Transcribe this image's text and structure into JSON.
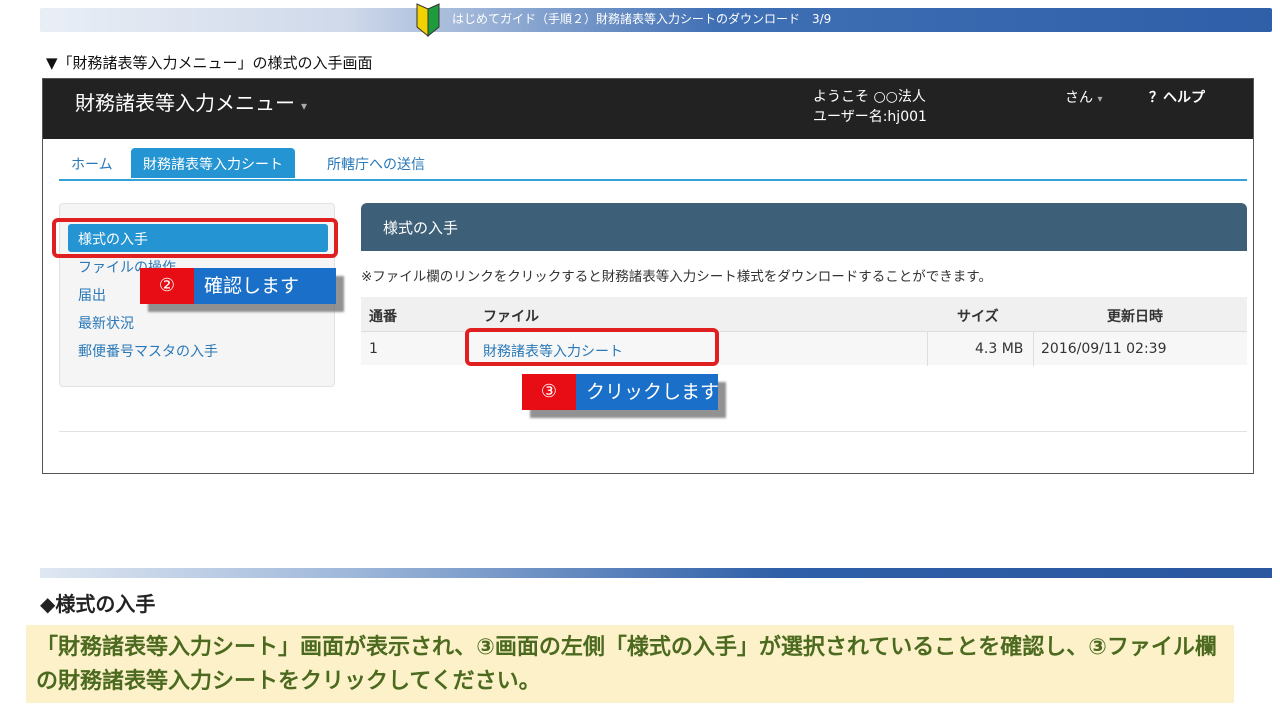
{
  "banner": {
    "text": "はじめてガイド（手順２）財務諸表等入力シートのダウンロード　3/9",
    "icon": "beginner-mark-icon"
  },
  "caption": "▼「財務諸表等入力メニュー」の様式の入手画面",
  "app": {
    "brand": "財務諸表等入力メニュー",
    "brand_caret": "▾",
    "welcome_line1": "ようこそ ○○法人",
    "welcome_line2": "ユーザー名:hj001",
    "user_label": "さん",
    "user_caret": "▾",
    "help_label": "？ヘルプ",
    "tabs": [
      {
        "label": "ホーム"
      },
      {
        "label": "財務諸表等入力シート",
        "active": true
      },
      {
        "label": "所轄庁への送信"
      }
    ],
    "sidebar": [
      {
        "label": "様式の入手",
        "active": true
      },
      {
        "label": "ファイルの操作"
      },
      {
        "label": "届出"
      },
      {
        "label": "最新状況"
      },
      {
        "label": "郵便番号マスタの入手"
      }
    ],
    "panel_title": "様式の入手",
    "note": "※ファイル欄のリンクをクリックすると財務諸表等入力シート様式をダウンロードすることができます。",
    "table": {
      "headers": [
        "通番",
        "ファイル",
        "サイズ",
        "更新日時"
      ],
      "rows": [
        {
          "no": "1",
          "file": "財務諸表等入力シート",
          "size": "4.3 MB",
          "updated": "2016/09/11 02:39"
        }
      ]
    }
  },
  "callouts": [
    {
      "num": "②",
      "text": "確認します"
    },
    {
      "num": "③",
      "text": "クリックします"
    }
  ],
  "colors": {
    "highlight": "#e02020",
    "callout_num": "#e80d15",
    "callout_text": "#1a6fc8",
    "navbar": "#222222",
    "accent": "#2494d3"
  },
  "section_title": "◆様式の入手",
  "description": "「財務諸表等入力シート」画面が表示され、③画面の左側「様式の入手」が選択されていることを確認し、③ファイル欄の財務諸表等入力シートをクリックしてください。"
}
